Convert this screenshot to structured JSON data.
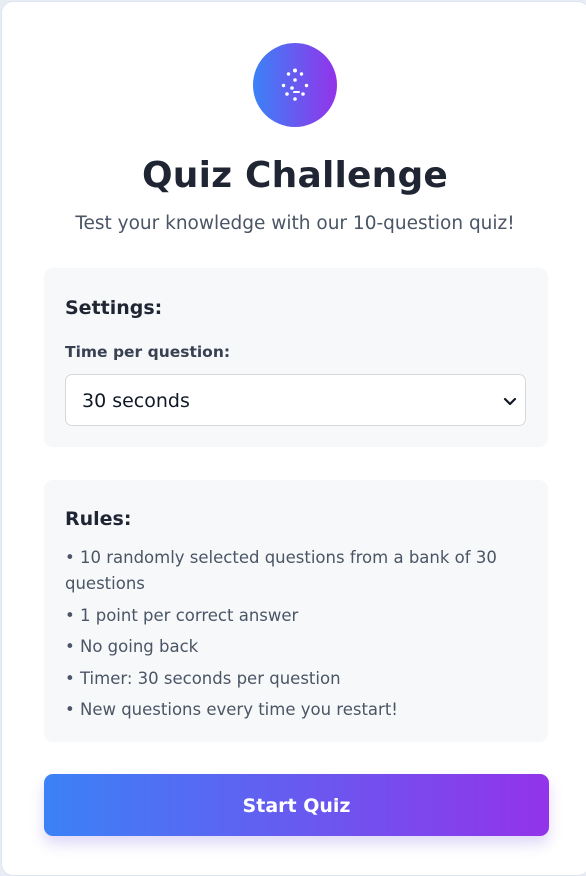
{
  "app": {
    "title": "Quiz Challenge",
    "subtitle": "Test your knowledge with our 10-question quiz!",
    "logo_icon": "lightbulb-icon",
    "accent_start": "#3b82f6",
    "accent_end": "#9333ea"
  },
  "settings": {
    "heading": "Settings:",
    "time_label": "Time per question:",
    "time_value": "30 seconds",
    "dropdown_icon": "chevron-down-icon"
  },
  "rules": {
    "heading": "Rules:",
    "items": [
      "• 10 randomly selected questions from a bank of 30 questions",
      "• 1 point per correct answer",
      "• No going back",
      "• Timer: 30 seconds per question",
      "• New questions every time you restart!"
    ]
  },
  "actions": {
    "start_label": "Start Quiz"
  }
}
